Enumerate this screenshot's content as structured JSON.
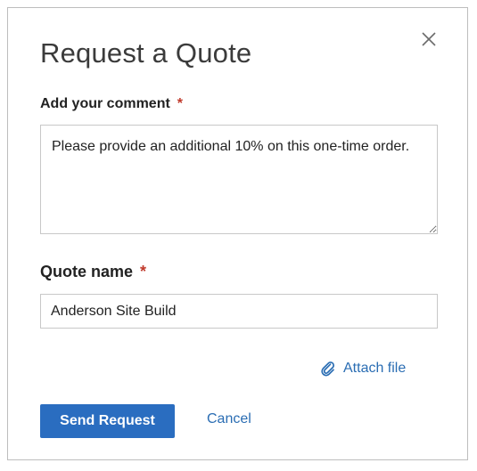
{
  "dialog": {
    "title": "Request a Quote",
    "close_icon": "close-icon"
  },
  "comment": {
    "label": "Add your comment",
    "required_marker": "*",
    "value": "Please provide an additional 10% on this one-time order."
  },
  "quote_name": {
    "label": "Quote name",
    "required_marker": "*",
    "value": "Anderson Site Build"
  },
  "attach": {
    "label": "Attach file",
    "icon": "paperclip-icon"
  },
  "actions": {
    "send_label": "Send Request",
    "cancel_label": "Cancel"
  },
  "colors": {
    "primary": "#2a6dc0",
    "link": "#2a6db3",
    "required": "#c0392b"
  }
}
